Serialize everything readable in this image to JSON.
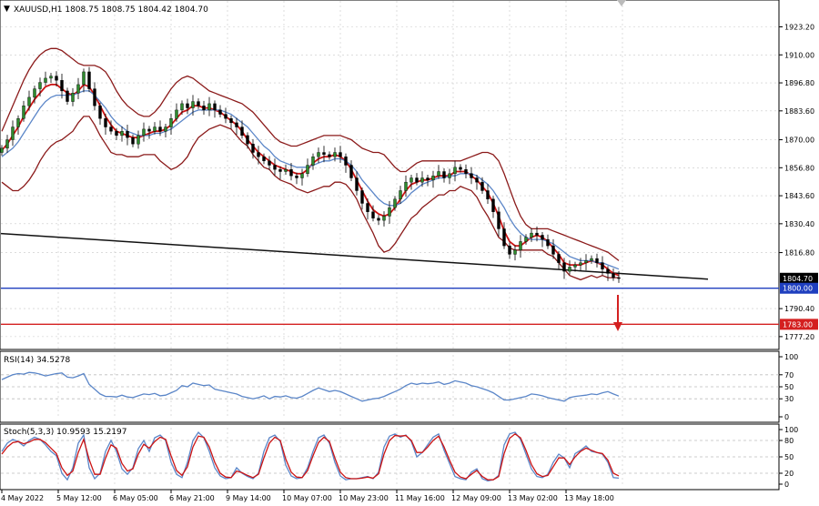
{
  "chart_data": [
    {
      "type": "candlestick",
      "title": "XAUUSD,H1  1808.75 1808.75 1804.42 1804.70",
      "ylim": [
        1772,
        1935
      ],
      "y_ticks": [
        "1923.20",
        "1910.00",
        "1896.80",
        "1883.60",
        "1870.00",
        "1856.80",
        "1843.60",
        "1830.40",
        "1816.80",
        "1790.40",
        "1777.20"
      ],
      "y_tick_values": [
        1923.2,
        1910.0,
        1896.8,
        1883.6,
        1870.0,
        1856.8,
        1843.6,
        1830.4,
        1816.8,
        1790.4,
        1777.2
      ],
      "x_ticks": [
        "4 May 2022",
        "5 May 12:00",
        "6 May 05:00",
        "6 May 21:00",
        "9 May 14:00",
        "10 May 07:00",
        "10 May 23:00",
        "11 May 16:00",
        "12 May 09:00",
        "13 May 02:00",
        "13 May 18:00"
      ],
      "price_labels": [
        {
          "text": "1804.70",
          "value": 1804.7,
          "bg": "#000000"
        },
        {
          "text": "1800.00",
          "value": 1800.0,
          "bg": "#1f3fbf"
        },
        {
          "text": "1783.00",
          "value": 1783.0,
          "bg": "#d42020"
        }
      ],
      "closes": [
        1866,
        1870,
        1876,
        1880,
        1886,
        1890,
        1894,
        1897,
        1899,
        1900,
        1898,
        1893,
        1888,
        1892,
        1896,
        1902,
        1894,
        1886,
        1880,
        1876,
        1874,
        1872,
        1874,
        1871,
        1868,
        1872,
        1875,
        1874,
        1876,
        1874,
        1876,
        1880,
        1884,
        1887,
        1885,
        1888,
        1886,
        1884,
        1887,
        1884,
        1882,
        1880,
        1878,
        1876,
        1872,
        1868,
        1864,
        1862,
        1860,
        1858,
        1856,
        1855,
        1856,
        1853,
        1852,
        1854,
        1858,
        1862,
        1864,
        1863,
        1862,
        1864,
        1862,
        1858,
        1852,
        1846,
        1840,
        1836,
        1833,
        1832,
        1834,
        1838,
        1842,
        1846,
        1850,
        1852,
        1850,
        1852,
        1851,
        1853,
        1855,
        1852,
        1854,
        1857,
        1856,
        1854,
        1852,
        1850,
        1846,
        1842,
        1836,
        1828,
        1820,
        1816,
        1818,
        1822,
        1824,
        1826,
        1825,
        1823,
        1820,
        1816,
        1812,
        1808,
        1810,
        1811,
        1812,
        1813,
        1814,
        1812,
        1809,
        1807,
        1805,
        1804.7
      ],
      "series": [
        {
          "name": "",
          "color": "#cc1414",
          "values": [
            1865,
            1868,
            1872,
            1876,
            1881,
            1885,
            1889,
            1892,
            1895,
            1896,
            1896,
            1894,
            1892,
            1891,
            1893,
            1896,
            1895,
            1891,
            1886,
            1881,
            1877,
            1874,
            1873,
            1872,
            1871,
            1871,
            1872,
            1873,
            1874,
            1874,
            1875,
            1877,
            1880,
            1883,
            1884,
            1886,
            1886,
            1885,
            1885,
            1884,
            1883,
            1881,
            1879,
            1877,
            1874,
            1870,
            1867,
            1864,
            1862,
            1860,
            1858,
            1857,
            1856,
            1855,
            1854,
            1854,
            1856,
            1859,
            1861,
            1862,
            1862,
            1863,
            1862,
            1860,
            1856,
            1851,
            1846,
            1841,
            1837,
            1835,
            1834,
            1835,
            1838,
            1842,
            1846,
            1849,
            1850,
            1851,
            1851,
            1852,
            1853,
            1853,
            1853,
            1855,
            1855,
            1855,
            1853,
            1851,
            1848,
            1845,
            1840,
            1834,
            1827,
            1822,
            1820,
            1820,
            1822,
            1824,
            1825,
            1824,
            1822,
            1819,
            1816,
            1812,
            1811,
            1811,
            1811,
            1812,
            1813,
            1812,
            1811,
            1809,
            1807,
            1806
          ]
        },
        {
          "name": "",
          "color": "#5b86c8",
          "values": [
            1862,
            1864,
            1866,
            1869,
            1873,
            1877,
            1881,
            1885,
            1888,
            1890,
            1891,
            1891,
            1891,
            1891,
            1892,
            1893,
            1893,
            1891,
            1888,
            1885,
            1881,
            1878,
            1876,
            1874,
            1873,
            1872,
            1872,
            1872,
            1873,
            1873,
            1874,
            1875,
            1877,
            1879,
            1881,
            1883,
            1884,
            1884,
            1884,
            1884,
            1884,
            1883,
            1882,
            1880,
            1878,
            1876,
            1873,
            1870,
            1867,
            1865,
            1862,
            1860,
            1859,
            1858,
            1857,
            1857,
            1857,
            1858,
            1859,
            1860,
            1860,
            1861,
            1861,
            1860,
            1858,
            1855,
            1851,
            1848,
            1845,
            1842,
            1840,
            1839,
            1839,
            1840,
            1842,
            1845,
            1847,
            1849,
            1850,
            1851,
            1852,
            1852,
            1853,
            1853,
            1854,
            1854,
            1854,
            1853,
            1851,
            1849,
            1846,
            1842,
            1838,
            1833,
            1829,
            1826,
            1824,
            1823,
            1823,
            1823,
            1822,
            1821,
            1819,
            1817,
            1815,
            1814,
            1813,
            1813,
            1813,
            1812,
            1812,
            1811,
            1810,
            1809
          ]
        },
        {
          "name": "",
          "color": "#8b1a1a",
          "values": [
            1874,
            1880,
            1886,
            1892,
            1898,
            1903,
            1907,
            1910,
            1912,
            1913,
            1913,
            1912,
            1910,
            1908,
            1906,
            1905,
            1905,
            1905,
            1904,
            1902,
            1898,
            1893,
            1889,
            1886,
            1884,
            1882,
            1881,
            1881,
            1883,
            1886,
            1890,
            1894,
            1897,
            1899,
            1900,
            1899,
            1897,
            1895,
            1893,
            1892,
            1891,
            1890,
            1889,
            1888,
            1887,
            1885,
            1883,
            1880,
            1877,
            1874,
            1871,
            1869,
            1868,
            1867,
            1867,
            1868,
            1869,
            1870,
            1871,
            1872,
            1872,
            1872,
            1872,
            1871,
            1870,
            1868,
            1866,
            1865,
            1864,
            1864,
            1863,
            1860,
            1857,
            1855,
            1855,
            1857,
            1859,
            1860,
            1860,
            1860,
            1860,
            1860,
            1860,
            1860,
            1860,
            1861,
            1862,
            1863,
            1864,
            1864,
            1863,
            1860,
            1854,
            1847,
            1840,
            1834,
            1830,
            1828,
            1828,
            1828,
            1828,
            1827,
            1826,
            1825,
            1824,
            1823,
            1822,
            1821,
            1820,
            1819,
            1818,
            1817,
            1815,
            1813
          ]
        },
        {
          "name": "",
          "color": "#8b1a1a",
          "values": [
            1850,
            1848,
            1846,
            1846,
            1848,
            1851,
            1855,
            1860,
            1864,
            1867,
            1869,
            1870,
            1872,
            1874,
            1878,
            1881,
            1881,
            1877,
            1872,
            1868,
            1864,
            1863,
            1863,
            1862,
            1862,
            1862,
            1863,
            1863,
            1863,
            1860,
            1858,
            1856,
            1857,
            1859,
            1862,
            1867,
            1871,
            1873,
            1875,
            1876,
            1877,
            1876,
            1875,
            1872,
            1869,
            1867,
            1863,
            1860,
            1857,
            1856,
            1853,
            1851,
            1850,
            1849,
            1847,
            1846,
            1845,
            1846,
            1847,
            1848,
            1848,
            1850,
            1850,
            1849,
            1846,
            1842,
            1836,
            1831,
            1826,
            1820,
            1817,
            1818,
            1821,
            1825,
            1829,
            1833,
            1835,
            1838,
            1840,
            1842,
            1844,
            1844,
            1846,
            1846,
            1848,
            1847,
            1846,
            1843,
            1838,
            1834,
            1829,
            1824,
            1822,
            1819,
            1818,
            1818,
            1818,
            1818,
            1818,
            1818,
            1816,
            1815,
            1812,
            1809,
            1806,
            1805,
            1804,
            1805,
            1806,
            1805,
            1806,
            1805,
            1805,
            1805
          ]
        }
      ],
      "trendline": {
        "start_value": 1825.8,
        "end_value": 1804.3,
        "color": "#111111"
      },
      "hlines": [
        {
          "value": 1800.0,
          "color": "#1f3fbf"
        },
        {
          "value": 1783.0,
          "color": "#d42020"
        }
      ]
    },
    {
      "type": "line",
      "title": "RSI(14) 34.5278",
      "ylim": [
        0,
        100
      ],
      "y_ticks": [
        "100",
        "70",
        "50",
        "30",
        "0"
      ],
      "y_tick_values": [
        100,
        70,
        50,
        30,
        0
      ],
      "levels": [
        70,
        50,
        30
      ],
      "series": [
        {
          "name": "",
          "color": "#5b86c8",
          "values": [
            62,
            66,
            70,
            72,
            71,
            74,
            73,
            71,
            68,
            70,
            72,
            73,
            66,
            65,
            68,
            72,
            54,
            46,
            38,
            34,
            34,
            33,
            36,
            33,
            32,
            35,
            38,
            37,
            39,
            35,
            36,
            40,
            44,
            52,
            50,
            56,
            54,
            52,
            53,
            46,
            44,
            42,
            40,
            38,
            34,
            32,
            30,
            32,
            35,
            30,
            34,
            33,
            35,
            32,
            31,
            34,
            39,
            44,
            48,
            45,
            42,
            44,
            42,
            38,
            34,
            30,
            26,
            28,
            30,
            31,
            34,
            38,
            42,
            46,
            52,
            56,
            54,
            56,
            55,
            56,
            58,
            54,
            56,
            60,
            58,
            56,
            52,
            50,
            47,
            44,
            40,
            34,
            28,
            28,
            30,
            32,
            34,
            38,
            37,
            35,
            32,
            30,
            28,
            26,
            32,
            34,
            35,
            36,
            38,
            37,
            40,
            42,
            38,
            34.5
          ]
        }
      ]
    },
    {
      "type": "line",
      "title": "Stoch(5,3,3) 10.9593 15.2197",
      "ylim": [
        0,
        100
      ],
      "y_ticks": [
        "100",
        "80",
        "50",
        "20",
        "0"
      ],
      "y_tick_values": [
        100,
        80,
        50,
        20,
        0
      ],
      "levels": [
        80,
        50,
        20
      ],
      "series": [
        {
          "name": "",
          "color": "#5b86c8",
          "values": [
            60,
            75,
            82,
            78,
            70,
            80,
            86,
            82,
            72,
            60,
            52,
            20,
            8,
            30,
            75,
            90,
            30,
            10,
            20,
            60,
            80,
            60,
            28,
            18,
            30,
            65,
            80,
            60,
            85,
            90,
            80,
            40,
            18,
            12,
            40,
            80,
            95,
            85,
            60,
            30,
            15,
            10,
            12,
            30,
            20,
            14,
            10,
            20,
            60,
            85,
            90,
            78,
            35,
            15,
            10,
            12,
            30,
            60,
            85,
            90,
            75,
            40,
            15,
            8,
            10,
            10,
            12,
            14,
            10,
            22,
            68,
            88,
            92,
            86,
            90,
            78,
            50,
            58,
            72,
            86,
            92,
            62,
            38,
            14,
            10,
            8,
            22,
            28,
            10,
            6,
            8,
            16,
            72,
            92,
            95,
            82,
            55,
            28,
            14,
            12,
            18,
            40,
            55,
            48,
            30,
            56,
            62,
            70,
            60,
            58,
            55,
            40,
            12,
            10.96
          ]
        },
        {
          "name": "",
          "color": "#cc1414",
          "values": [
            55,
            68,
            76,
            78,
            74,
            77,
            82,
            82,
            76,
            66,
            56,
            30,
            16,
            24,
            58,
            82,
            45,
            18,
            18,
            48,
            72,
            66,
            38,
            24,
            28,
            55,
            73,
            66,
            78,
            86,
            82,
            52,
            25,
            16,
            32,
            68,
            88,
            86,
            68,
            40,
            20,
            13,
            12,
            24,
            21,
            16,
            12,
            18,
            48,
            75,
            86,
            80,
            46,
            22,
            13,
            12,
            25,
            52,
            76,
            86,
            78,
            48,
            22,
            12,
            10,
            10,
            11,
            13,
            11,
            19,
            55,
            80,
            89,
            88,
            89,
            80,
            58,
            58,
            68,
            80,
            88,
            68,
            44,
            22,
            13,
            10,
            18,
            25,
            14,
            8,
            8,
            14,
            56,
            84,
            92,
            85,
            62,
            36,
            19,
            14,
            16,
            32,
            48,
            48,
            36,
            50,
            60,
            66,
            62,
            58,
            56,
            44,
            20,
            15.22
          ]
        }
      ]
    }
  ]
}
